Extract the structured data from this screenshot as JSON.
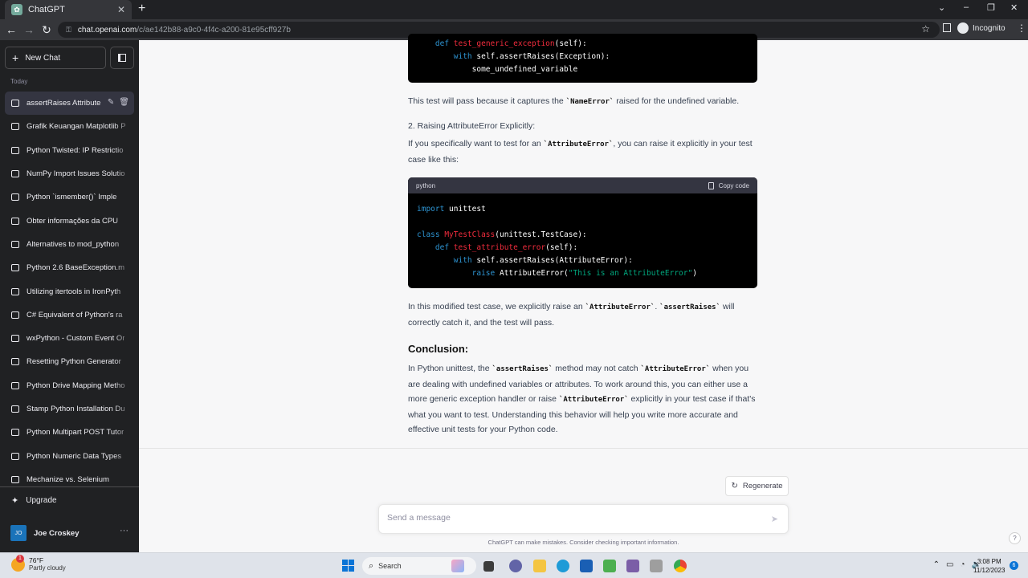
{
  "browser": {
    "tab_title": "ChatGPT",
    "tab_close": "✕",
    "new_tab": "+",
    "url_host": "chat.openai.com",
    "url_path": "/c/ae142b88-a9c0-4f4c-a200-81e95cff927b",
    "incognito_label": "Incognito",
    "window_controls": [
      "⌄",
      "–",
      "❐",
      "✕"
    ]
  },
  "sidebar": {
    "new_chat_label": "New Chat",
    "section_label": "Today",
    "chats": [
      "assertRaises Attribute",
      "Grafik Keuangan Matplotlib P",
      "Python Twisted: IP Restrictio",
      "NumPy Import Issues Solutio",
      "Python `ismember()` Imple",
      "Obter informações da CPU",
      "Alternatives to mod_python",
      "Python 2.6 BaseException.m",
      "Utilizing itertools in IronPyth",
      "C# Equivalent of Python's ra",
      "wxPython - Custom Event Or",
      "Resetting Python Generator",
      "Python Drive Mapping Metho",
      "Stamp Python Installation Du",
      "Python Multipart POST Tutor",
      "Python Numeric Data Types",
      "Mechanize vs. Selenium"
    ],
    "active_index": 0,
    "upgrade_label": "Upgrade",
    "user_initials": "JO",
    "user_name": "Joe Croskey",
    "user_more": "···"
  },
  "answer": {
    "code_top_lines": [
      {
        "indent": "    ",
        "parts": [
          [
            "kw",
            "def "
          ],
          [
            "fn",
            "test_generic_exception"
          ],
          [
            "",
            "(self):"
          ]
        ]
      },
      {
        "indent": "        ",
        "parts": [
          [
            "kw",
            "with "
          ],
          [
            "",
            "self.assertRaises(Exception):"
          ]
        ]
      },
      {
        "indent": "            ",
        "parts": [
          [
            "",
            "some_undefined_variable"
          ]
        ]
      }
    ],
    "p1_a": "This test will pass because it captures the ",
    "p1_code": "`NameError`",
    "p1_b": " raised for the undefined variable.",
    "heading2": "2. Raising AttributeError Explicitly:",
    "p2_a": "If you specifically want to test for an ",
    "p2_code": "`AttributeError`",
    "p2_b": ", you can raise it explicitly in your test case like this:",
    "code_lang": "python",
    "copy_label": "Copy code",
    "code_lines": [
      {
        "indent": "",
        "parts": [
          [
            "kw",
            "import "
          ],
          [
            "",
            "unittest"
          ]
        ]
      },
      {
        "indent": "",
        "parts": []
      },
      {
        "indent": "",
        "parts": [
          [
            "kw",
            "class "
          ],
          [
            "cls",
            "MyTestClass"
          ],
          [
            "",
            "(unittest.TestCase):"
          ]
        ]
      },
      {
        "indent": "    ",
        "parts": [
          [
            "kw",
            "def "
          ],
          [
            "fn",
            "test_attribute_error"
          ],
          [
            "",
            "(self):"
          ]
        ]
      },
      {
        "indent": "        ",
        "parts": [
          [
            "kw",
            "with "
          ],
          [
            "",
            "self.assertRaises(AttributeError):"
          ]
        ]
      },
      {
        "indent": "            ",
        "parts": [
          [
            "kw",
            "raise "
          ],
          [
            "",
            "AttributeError("
          ],
          [
            "str",
            "\"This is an AttributeError\""
          ],
          [
            "",
            ")"
          ]
        ]
      }
    ],
    "p3_a": "In this modified test case, we explicitly raise an ",
    "p3_code1": "`AttributeError`",
    "p3_mid": ". ",
    "p3_code2": "`assertRaises`",
    "p3_b": " will correctly catch it, and the test will pass.",
    "conclusion_heading": "Conclusion:",
    "p4_a": "In Python unittest, the ",
    "p4_code1": "`assertRaises`",
    "p4_b": " method may not catch ",
    "p4_code2": "`AttributeError`",
    "p4_c": " when you are dealing with undefined variables or attributes. To work around this, you can either use a more generic exception handler or raise ",
    "p4_code3": "`AttributeError`",
    "p4_d": " explicitly in your test case if that's what you want to test. Understanding this behavior will help you write more accurate and effective unit tests for your Python code."
  },
  "regenerate_label": "Regenerate",
  "input": {
    "placeholder": "Send a message"
  },
  "disclaimer": "ChatGPT can make mistakes. Consider checking important information.",
  "help_label": "?",
  "taskbar": {
    "weather_temp": "76°F",
    "weather_desc": "Partly cloudy",
    "weather_badge": "1",
    "search_label": "Search",
    "time": "3:08 PM",
    "date": "11/12/2023",
    "notifications": "6"
  },
  "colors": {
    "sidebar_bg": "#202123",
    "main_bg": "#f7f7f8",
    "code_bg": "#000000",
    "keyword": "#2e95d3",
    "class_name": "#f22c3d",
    "string": "#00a67d"
  }
}
